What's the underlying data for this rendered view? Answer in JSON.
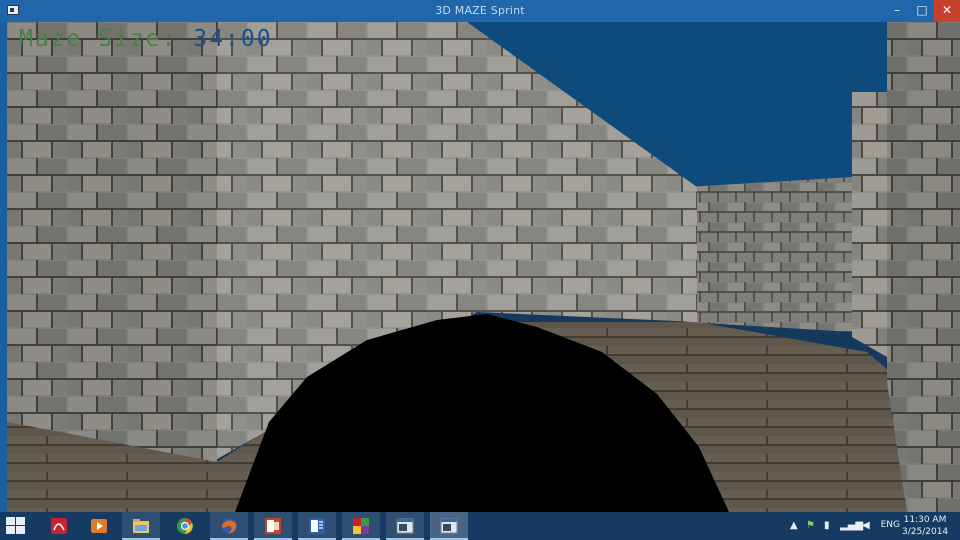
{
  "window": {
    "title": "3D MAZE Sprint",
    "minimize_glyph": "–",
    "maximize_glyph": "□",
    "close_glyph": "✕"
  },
  "hud": {
    "label": "Maze Size:",
    "value": "34:00"
  },
  "scene": {
    "sky_color": "#0f4a7c",
    "wall_color": "#8e8e8a",
    "floor_color": "#5b5348",
    "player_color": "#000000"
  },
  "taskbar": {
    "start_icon": "windows-logo-icon",
    "apps": [
      {
        "name": "acrobat-reader-icon",
        "color": "#c7232f"
      },
      {
        "name": "media-player-icon",
        "color": "#e07b2a"
      },
      {
        "name": "file-explorer-icon",
        "color": "#e9c46a"
      },
      {
        "name": "chrome-icon",
        "color": "#3b9a4a"
      },
      {
        "name": "firefox-icon",
        "color": "#e66a1f"
      },
      {
        "name": "powerpoint-icon",
        "color": "#c44325"
      },
      {
        "name": "word-icon",
        "color": "#2b5fa8"
      },
      {
        "name": "colorful-app-icon",
        "color": "#7a3c9a"
      },
      {
        "name": "window-app-icon",
        "color": "#dce6ee"
      },
      {
        "name": "window-app-icon-active",
        "color": "#dce6ee"
      }
    ],
    "tray": {
      "language": "ENG",
      "time": "11:30 AM",
      "date": "3/25/2014"
    }
  }
}
